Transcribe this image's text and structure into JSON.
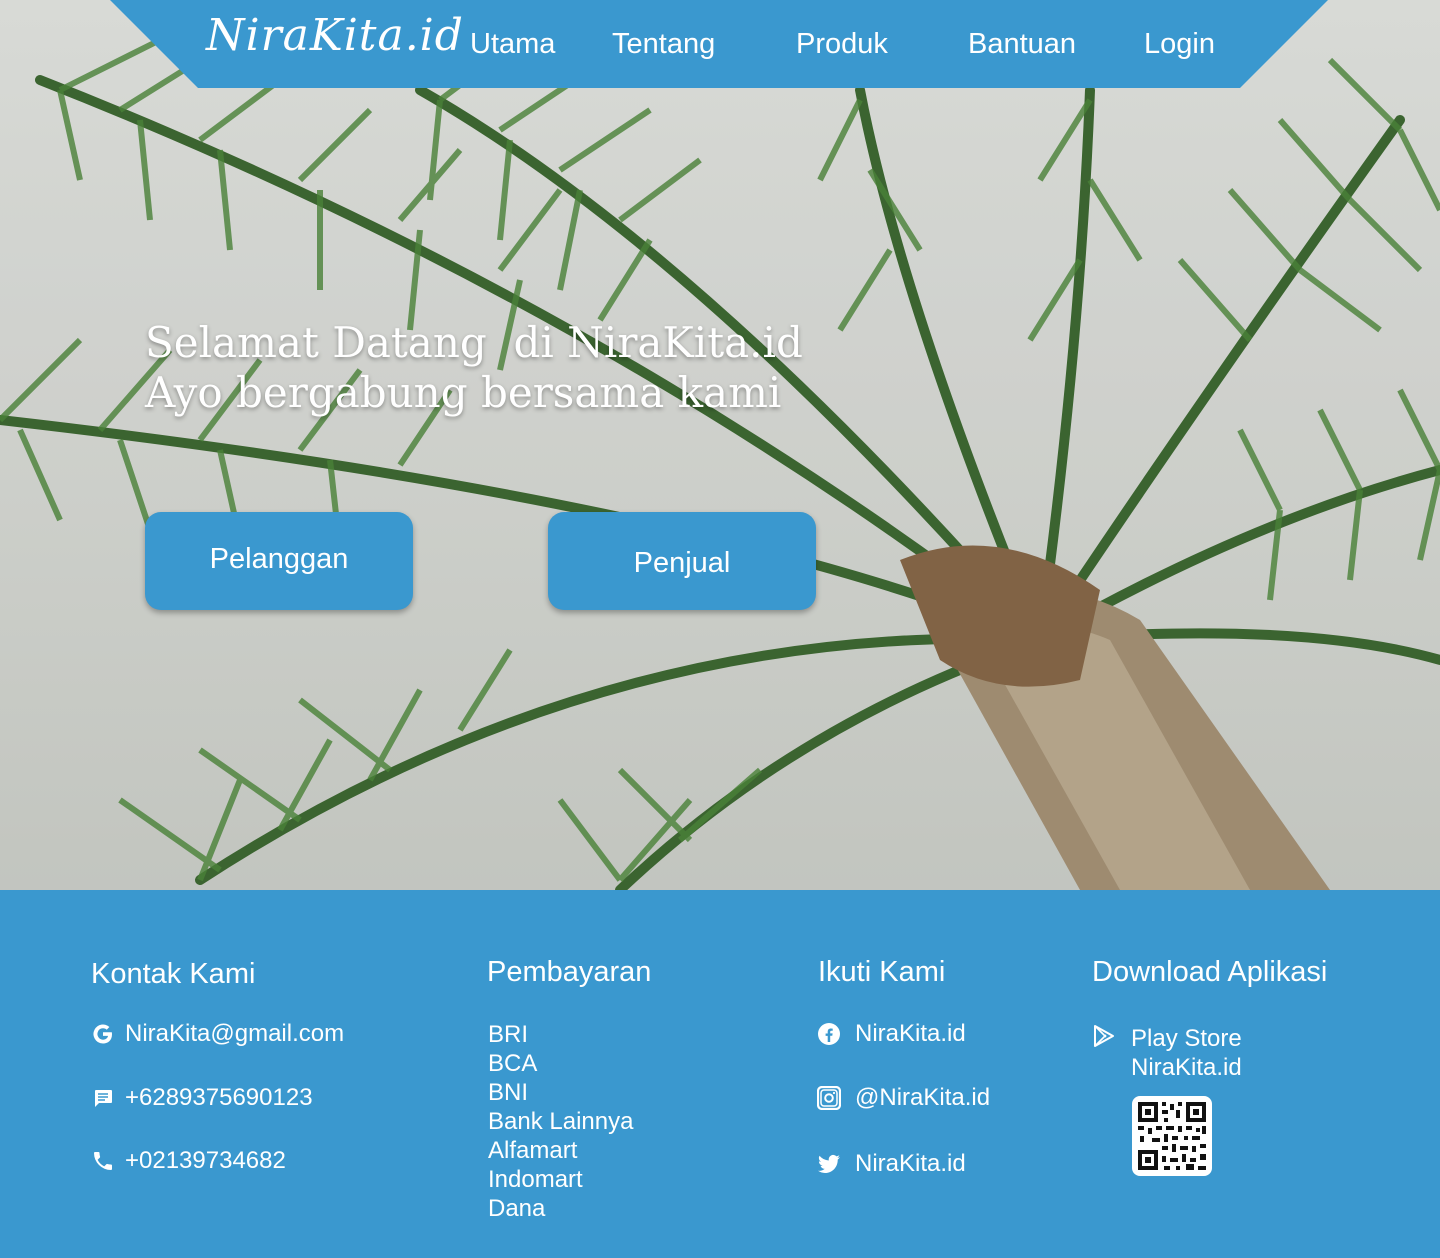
{
  "nav": {
    "logo": "NiraKita.id",
    "items": [
      "Utama",
      "Tentang",
      "Produk",
      "Bantuan",
      "Login"
    ]
  },
  "hero": {
    "headline_line1": "Selamat Datang  di NiraKita.id",
    "headline_line2": "Ayo bergabung bersama kami",
    "buttons": {
      "customer": "Pelanggan",
      "seller": "Penjual"
    }
  },
  "footer": {
    "contact": {
      "heading": "Kontak Kami",
      "email": "NiraKita@gmail.com",
      "sms": "+6289375690123",
      "phone": "+02139734682"
    },
    "payment": {
      "heading": "Pembayaran",
      "methods": [
        "BRI",
        "BCA",
        "BNI",
        "Bank Lainnya",
        "Alfamart",
        "Indomart",
        "Dana"
      ]
    },
    "follow": {
      "heading": "Ikuti Kami",
      "facebook": "NiraKita.id",
      "instagram": "@NiraKita.id",
      "twitter": "NiraKita.id"
    },
    "download": {
      "heading": "Download Aplikasi",
      "store": "Play Store",
      "app_name": "NiraKita.id"
    }
  },
  "colors": {
    "brand_blue": "#3a98cf",
    "text": "#ffffff"
  },
  "icons": [
    "google-icon",
    "message-icon",
    "phone-icon",
    "facebook-icon",
    "instagram-icon",
    "twitter-icon",
    "play-store-icon",
    "qr-code-icon"
  ]
}
